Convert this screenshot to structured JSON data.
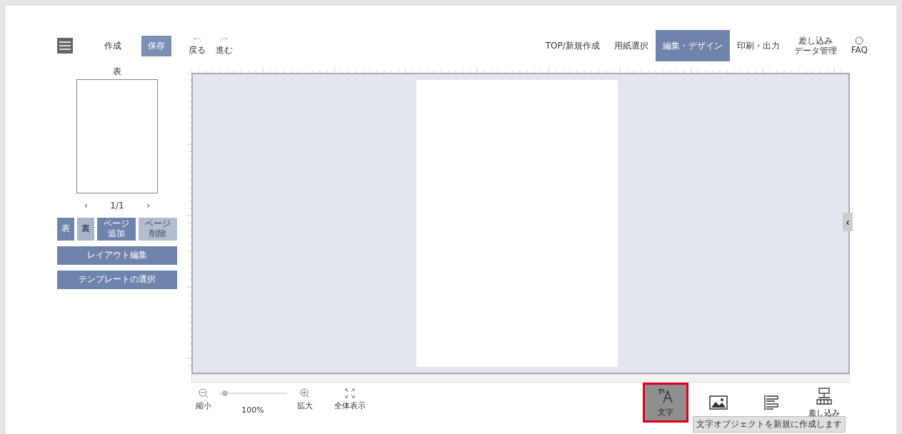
{
  "toolbar": {
    "create_label": "作成",
    "save_button": "保存",
    "undo": "戻る",
    "redo": "進む"
  },
  "nav_tabs": [
    {
      "label": "TOP/新規作成",
      "selected": false
    },
    {
      "label": "用紙選択",
      "selected": false
    },
    {
      "label": "編集・デザイン",
      "selected": true
    },
    {
      "label": "印刷・出力",
      "selected": false
    },
    {
      "lines": [
        "差し込み",
        "データ管理"
      ],
      "selected": false
    },
    {
      "label": "FAQ",
      "selected": false
    }
  ],
  "sidebar": {
    "side_label": "表",
    "prev": "‹",
    "page_indicator": "1/1",
    "next": "›",
    "view_buttons": [
      {
        "label": "表",
        "selected": true
      },
      {
        "label": "裏",
        "selected": false
      }
    ],
    "page_buttons": [
      {
        "lines": [
          "ページ",
          "追加"
        ],
        "disabled": false
      },
      {
        "lines": [
          "ページ",
          "削除"
        ],
        "disabled": true
      }
    ],
    "actions": [
      "レイアウト編集",
      "テンプレートの選択"
    ]
  },
  "canvas": {
    "collapse_tab": "‹"
  },
  "zoom": {
    "zoom_out": "縮小",
    "level": 0.1,
    "reading": "100%",
    "zoom_in": "拡大",
    "fit": "全体表示"
  },
  "tools": [
    {
      "kind": "text",
      "label": "文字",
      "selected": true,
      "highlighted": true
    },
    {
      "kind": "image",
      "selected": false,
      "highlighted": false
    },
    {
      "kind": "list",
      "selected": false,
      "highlighted": false
    },
    {
      "kind": "merge",
      "label": "差し込み",
      "selected": false,
      "highlighted": false
    }
  ],
  "tooltip": "文字オブジェクトを新規に作成します"
}
